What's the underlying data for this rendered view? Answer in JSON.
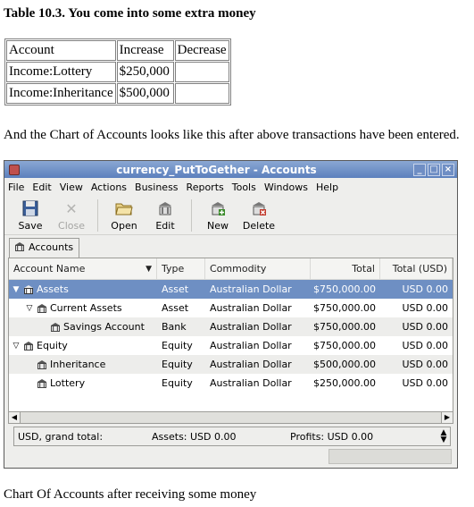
{
  "doc": {
    "table_title": "Table 10.3. You come into some extra money",
    "intro": "And the Chart of Accounts looks like this after above transactions have been entered.",
    "caption": "Chart Of Accounts after receiving some money",
    "table": {
      "headers": [
        "Account",
        "Increase",
        "Decrease"
      ],
      "rows": [
        [
          "Income:Lottery",
          "$250,000",
          ""
        ],
        [
          "Income:Inheritance",
          "$500,000",
          ""
        ]
      ]
    }
  },
  "window": {
    "title": "currency_PutToGether - Accounts",
    "menu": [
      "File",
      "Edit",
      "View",
      "Actions",
      "Business",
      "Reports",
      "Tools",
      "Windows",
      "Help"
    ],
    "toolbar": {
      "save": "Save",
      "close": "Close",
      "open": "Open",
      "edit": "Edit",
      "new": "New",
      "delete": "Delete"
    },
    "tab": "Accounts",
    "columns": {
      "name": "Account Name",
      "type": "Type",
      "commodity": "Commodity",
      "total": "Total",
      "total_usd": "Total (USD)"
    },
    "rows": [
      {
        "name": "Assets",
        "type": "Asset",
        "commodity": "Australian Dollar",
        "total": "$750,000.00",
        "usd": "USD 0.00"
      },
      {
        "name": "Current Assets",
        "type": "Asset",
        "commodity": "Australian Dollar",
        "total": "$750,000.00",
        "usd": "USD 0.00"
      },
      {
        "name": "Savings Account",
        "type": "Bank",
        "commodity": "Australian Dollar",
        "total": "$750,000.00",
        "usd": "USD 0.00"
      },
      {
        "name": "Equity",
        "type": "Equity",
        "commodity": "Australian Dollar",
        "total": "$750,000.00",
        "usd": "USD 0.00"
      },
      {
        "name": "Inheritance",
        "type": "Equity",
        "commodity": "Australian Dollar",
        "total": "$500,000.00",
        "usd": "USD 0.00"
      },
      {
        "name": "Lottery",
        "type": "Equity",
        "commodity": "Australian Dollar",
        "total": "$250,000.00",
        "usd": "USD 0.00"
      }
    ],
    "summary": {
      "grand": "USD, grand total:",
      "assets": "Assets: USD 0.00",
      "profits": "Profits: USD 0.00"
    }
  },
  "colors": {
    "selection": "#6e8fc3",
    "titlebar": "#6f8ec4"
  }
}
